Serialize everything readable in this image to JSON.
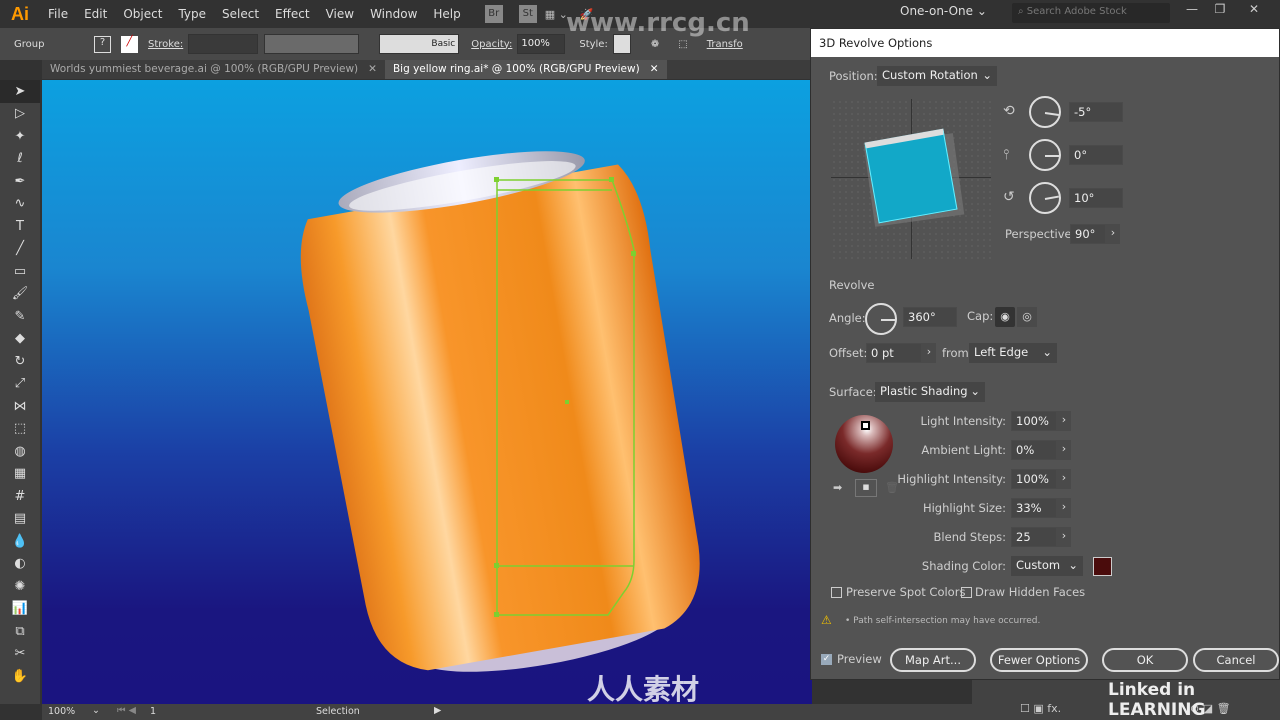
{
  "app": {
    "logo": "Ai",
    "menus": [
      "File",
      "Edit",
      "Object",
      "Type",
      "Select",
      "Effect",
      "View",
      "Window",
      "Help"
    ],
    "bridge": "Br",
    "stock": "St",
    "workspace": "One-on-One",
    "search_placeholder": "Search Adobe Stock",
    "window_controls": [
      "minimize-icon",
      "restore-icon",
      "close-icon"
    ]
  },
  "control_bar": {
    "selection_type": "Group",
    "fill": "?",
    "stroke_label": "Stroke:",
    "brush": "Basic",
    "opacity_label": "Opacity:",
    "opacity": "100%",
    "style_label": "Style:",
    "transform_label": "Transfo"
  },
  "tabs": [
    {
      "label": "Worlds yummiest beverage.ai @ 100% (RGB/GPU Preview)",
      "active": false
    },
    {
      "label": "Big yellow ring.ai* @ 100% (RGB/GPU Preview)",
      "active": true
    }
  ],
  "tools": [
    "selection",
    "direct-selection",
    "magic-wand",
    "lasso",
    "pen",
    "curvature",
    "type",
    "line",
    "rectangle",
    "paintbrush",
    "shaper",
    "eraser",
    "rotate",
    "scale",
    "width",
    "free-transform",
    "shape-builder",
    "perspective-grid",
    "mesh",
    "gradient",
    "eyedropper",
    "blend",
    "symbol-sprayer",
    "column-graph",
    "artboard",
    "slice",
    "hand"
  ],
  "status": {
    "zoom": "100%",
    "artboard": "1",
    "tool": "Selection"
  },
  "watermark": {
    "site": "www.rrcg.cn",
    "brand": "人人素材",
    "learning": "Linked in LEARNING"
  },
  "dialog": {
    "title": "3D Revolve Options",
    "position_label": "Position:",
    "position": "Custom Rotation",
    "rot_x": "-5°",
    "rot_y": "0°",
    "rot_z": "10°",
    "perspective_label": "Perspective:",
    "perspective": "90°",
    "revolve_heading": "Revolve",
    "angle_label": "Angle:",
    "angle": "360°",
    "cap_label": "Cap:",
    "offset_label": "Offset:",
    "offset": "0 pt",
    "from_label": "from",
    "from": "Left Edge",
    "surface_label": "Surface:",
    "surface": "Plastic Shading",
    "light_intensity_label": "Light Intensity:",
    "light_intensity": "100%",
    "ambient_label": "Ambient Light:",
    "ambient": "0%",
    "highlight_intensity_label": "Highlight Intensity:",
    "highlight_intensity": "100%",
    "highlight_size_label": "Highlight Size:",
    "highlight_size": "33%",
    "blend_steps_label": "Blend Steps:",
    "blend_steps": "25",
    "shading_color_label": "Shading Color:",
    "shading_color": "Custom",
    "shading_swatch": "#4a0c0c",
    "preserve_spot": "Preserve Spot Colors",
    "preserve_spot_checked": false,
    "draw_hidden": "Draw Hidden Faces",
    "draw_hidden_checked": false,
    "warning": "• Path self-intersection may have occurred.",
    "preview": "Preview",
    "preview_checked": true,
    "map_art": "Map Art...",
    "fewer_options": "Fewer Options",
    "ok": "OK",
    "cancel": "Cancel"
  }
}
